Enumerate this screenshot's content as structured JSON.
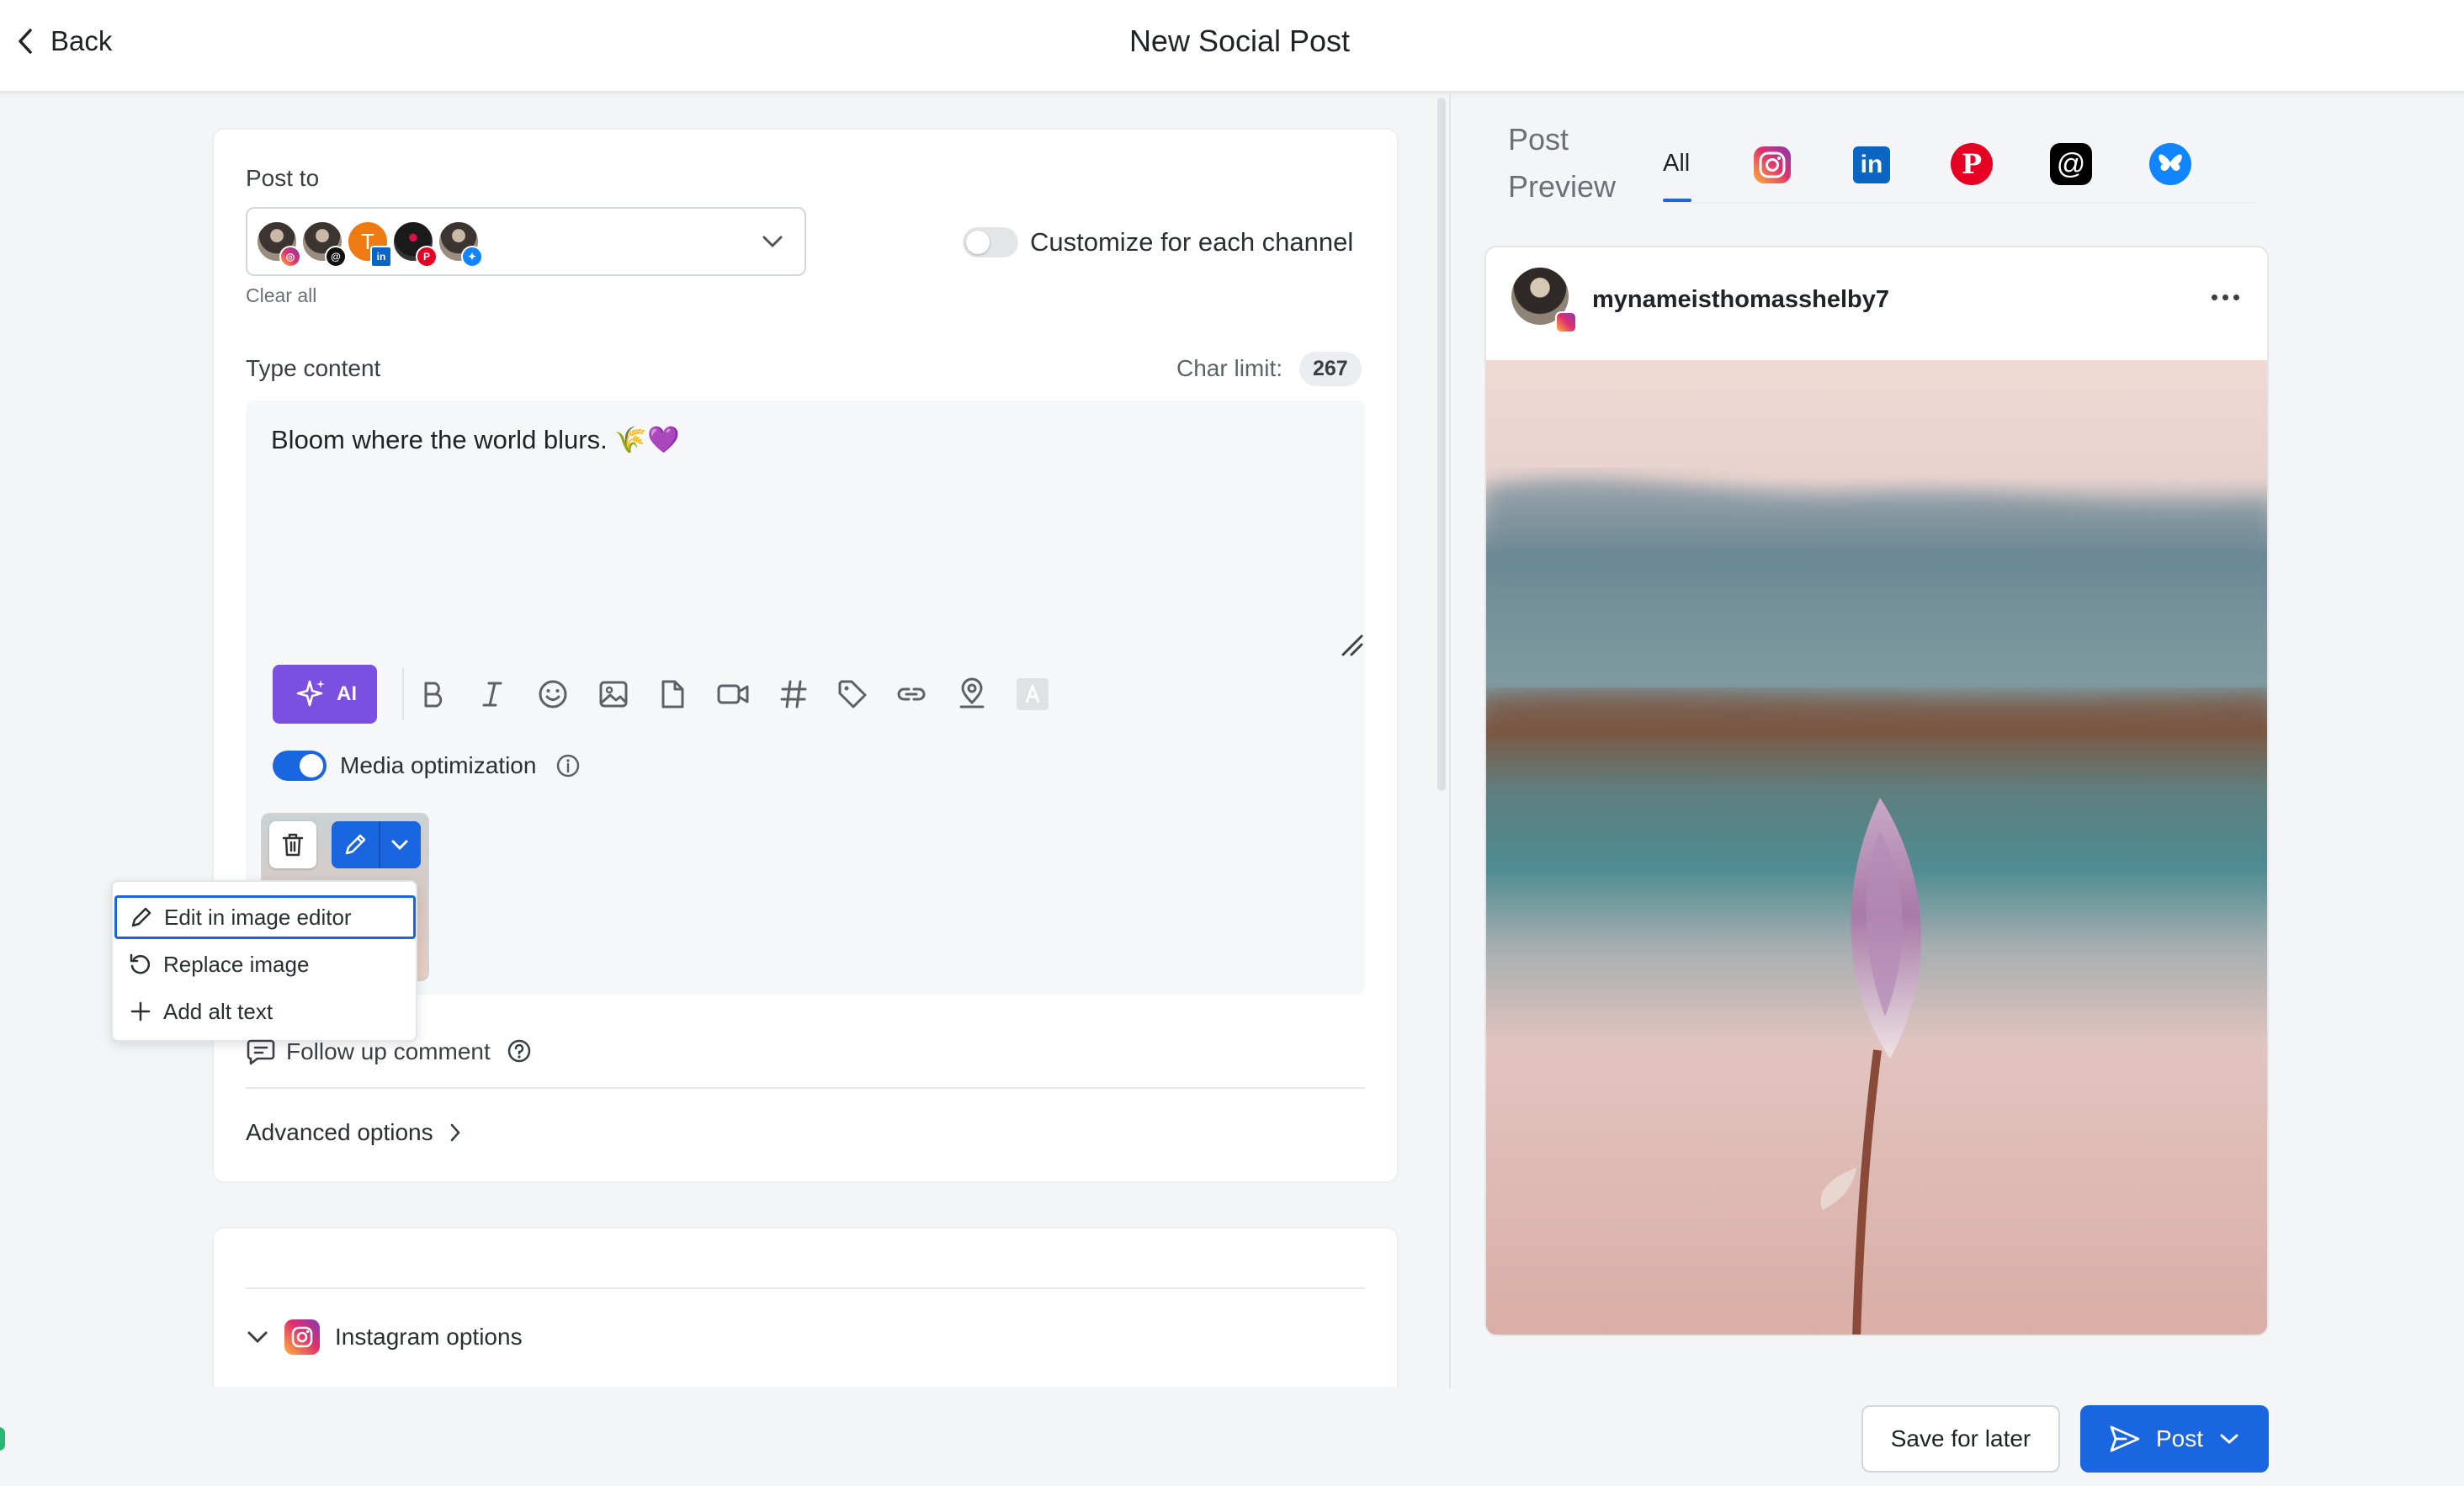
{
  "header": {
    "back_label": "Back",
    "title": "New Social Post"
  },
  "editor": {
    "post_to_label": "Post to",
    "clear_all": "Clear all",
    "customize_label": "Customize for each channel",
    "type_content_label": "Type content",
    "char_limit_label": "Char limit:",
    "char_limit_value": "267",
    "content_text": "Bloom where the world blurs. 🌾💜",
    "ai_label": "AI",
    "media_opt_label": "Media optimization",
    "media_opt_enabled": true,
    "follow_up_label": "Follow up comment",
    "advanced_label": "Advanced options",
    "instagram_options_label": "Instagram options",
    "channels": [
      {
        "network": "instagram"
      },
      {
        "network": "threads"
      },
      {
        "network": "linkedin",
        "initial": "T"
      },
      {
        "network": "pinterest"
      },
      {
        "network": "bluesky"
      }
    ]
  },
  "image_menu": {
    "items": [
      "Edit in image editor",
      "Replace image",
      "Add alt text"
    ]
  },
  "preview": {
    "title_line1": "Post",
    "title_line2": "Preview",
    "tab_all": "All",
    "tabs": [
      "instagram-icon",
      "linkedin-icon",
      "pinterest-icon",
      "threads-icon",
      "bluesky-icon"
    ],
    "username": "mynameisthomasshelby7"
  },
  "footer": {
    "save_label": "Save for later",
    "post_label": "Post"
  },
  "colors": {
    "primary": "#1a66e0",
    "ai": "#7b4fe0",
    "instagram": "#e1306c",
    "linkedin": "#0a66c2",
    "pinterest": "#e60023",
    "bluesky": "#1185fe"
  }
}
